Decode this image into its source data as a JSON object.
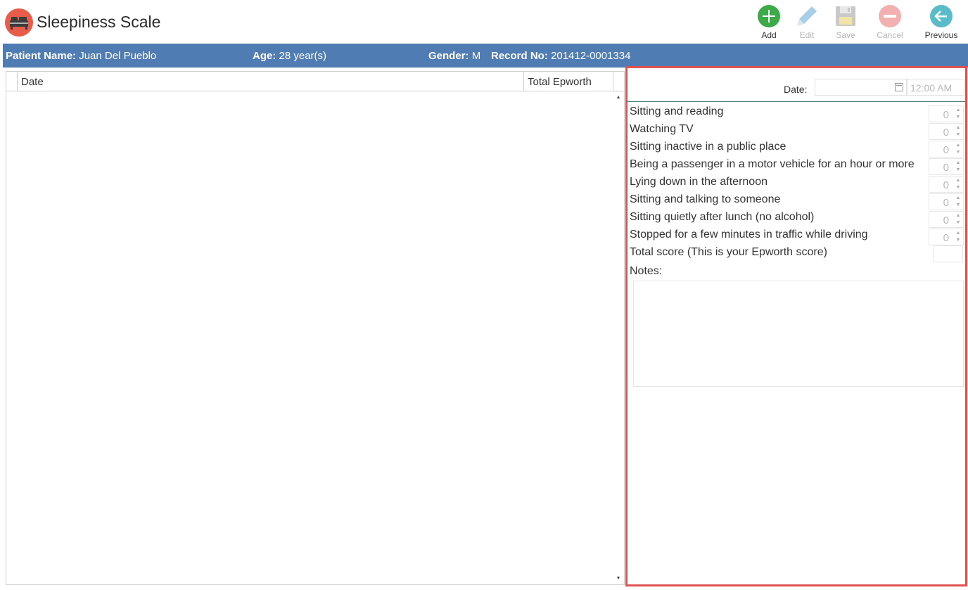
{
  "app": {
    "title": "Sleepiness Scale",
    "icon": "bed-icon",
    "accent": "#e85c4a"
  },
  "toolbar": {
    "add_label": "Add",
    "edit_label": "Edit",
    "save_label": "Save",
    "cancel_label": "Cancel",
    "previous_label": "Previous"
  },
  "patient": {
    "name_label": "Patient Name:",
    "name": "Juan Del Pueblo",
    "age_label": "Age:",
    "age": "28 year(s)",
    "gender_label": "Gender:",
    "gender": "M",
    "record_label": "Record No:",
    "record": "201412-0001334",
    "bar_color": "#4f7cb3"
  },
  "grid": {
    "columns": [
      "Date",
      "Total Epworth"
    ],
    "rows": []
  },
  "form": {
    "date_label": "Date:",
    "date_value": "",
    "time_value": "12:00 AM",
    "questions": [
      {
        "label": "Sitting and reading",
        "value": "0"
      },
      {
        "label": "Watching TV",
        "value": "0"
      },
      {
        "label": "Sitting inactive in a public place",
        "value": "0"
      },
      {
        "label": "Being a passenger in a motor vehicle for an hour or more",
        "value": "0"
      },
      {
        "label": "Lying down in the afternoon",
        "value": "0"
      },
      {
        "label": "Sitting and talking to someone",
        "value": "0"
      },
      {
        "label": "Sitting quietly after lunch (no alcohol)",
        "value": "0"
      },
      {
        "label": "Stopped for a few minutes in traffic while driving",
        "value": "0"
      }
    ],
    "total_label": "Total score (This is your Epworth score)",
    "total_value": "",
    "notes_label": "Notes:",
    "notes_value": ""
  }
}
